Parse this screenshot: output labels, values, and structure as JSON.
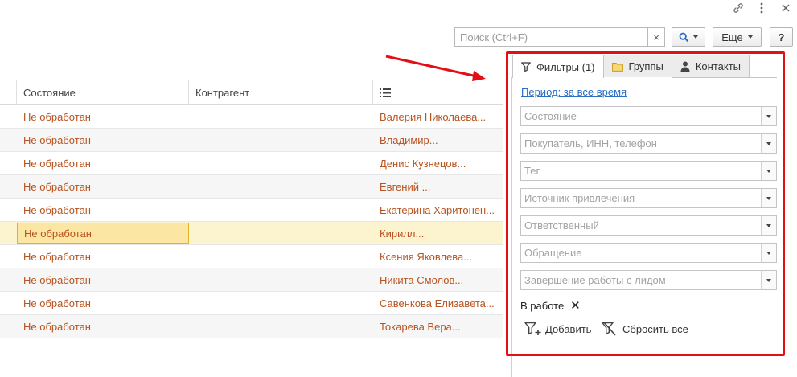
{
  "window": {
    "link_icon": "link-icon",
    "more_icon": "vertical-dots-icon",
    "close_icon": "close-icon"
  },
  "search": {
    "placeholder": "Поиск (Ctrl+F)",
    "value": "",
    "clear_label": "×",
    "find_icon": "magnifier-icon",
    "more_label": "Еще",
    "help_label": "?"
  },
  "table": {
    "columns": [
      "Состояние",
      "Контрагент"
    ],
    "column3_icon": "list-icon",
    "rows": [
      {
        "state": "Не обработан",
        "counterparty": "",
        "contact": "Валерия Николаева..."
      },
      {
        "state": "Не обработан",
        "counterparty": "",
        "contact": "Владимир..."
      },
      {
        "state": "Не обработан",
        "counterparty": "",
        "contact": "Денис Кузнецов..."
      },
      {
        "state": "Не обработан",
        "counterparty": "",
        "contact": "Евгений ..."
      },
      {
        "state": "Не обработан",
        "counterparty": "",
        "contact": "Екатерина Харитонен..."
      },
      {
        "state": "Не обработан",
        "counterparty": "",
        "contact": "Кирилл..."
      },
      {
        "state": "Не обработан",
        "counterparty": "",
        "contact": "Ксения Яковлева..."
      },
      {
        "state": "Не обработан",
        "counterparty": "",
        "contact": "Никита Смолов..."
      },
      {
        "state": "Не обработан",
        "counterparty": "",
        "contact": "Савенкова Елизавета..."
      },
      {
        "state": "Не обработан",
        "counterparty": "",
        "contact": "Токарева Вера..."
      }
    ],
    "selected_row": 5,
    "text_color": "#b8531f",
    "selected_color": "#fcf3cf"
  },
  "panel": {
    "tabs": [
      {
        "label": "Фильтры (1)",
        "icon": "funnel-icon"
      },
      {
        "label": "Группы",
        "icon": "folder-icon"
      },
      {
        "label": "Контакты",
        "icon": "person-icon"
      }
    ],
    "active_tab": 0,
    "period_link": "Период: за все время",
    "filters": [
      {
        "placeholder": "Состояние"
      },
      {
        "placeholder": "Покупатель, ИНН, телефон"
      },
      {
        "placeholder": "Тег"
      },
      {
        "placeholder": "Источник привлечения"
      },
      {
        "placeholder": "Ответственный"
      },
      {
        "placeholder": "Обращение"
      },
      {
        "placeholder": "Завершение работы с лидом"
      }
    ],
    "active_filter": {
      "label": "В работе",
      "remove_label": "✕"
    },
    "add_label": "Добавить",
    "reset_label": "Сбросить все"
  },
  "annotation": {
    "color": "#e30f14"
  }
}
